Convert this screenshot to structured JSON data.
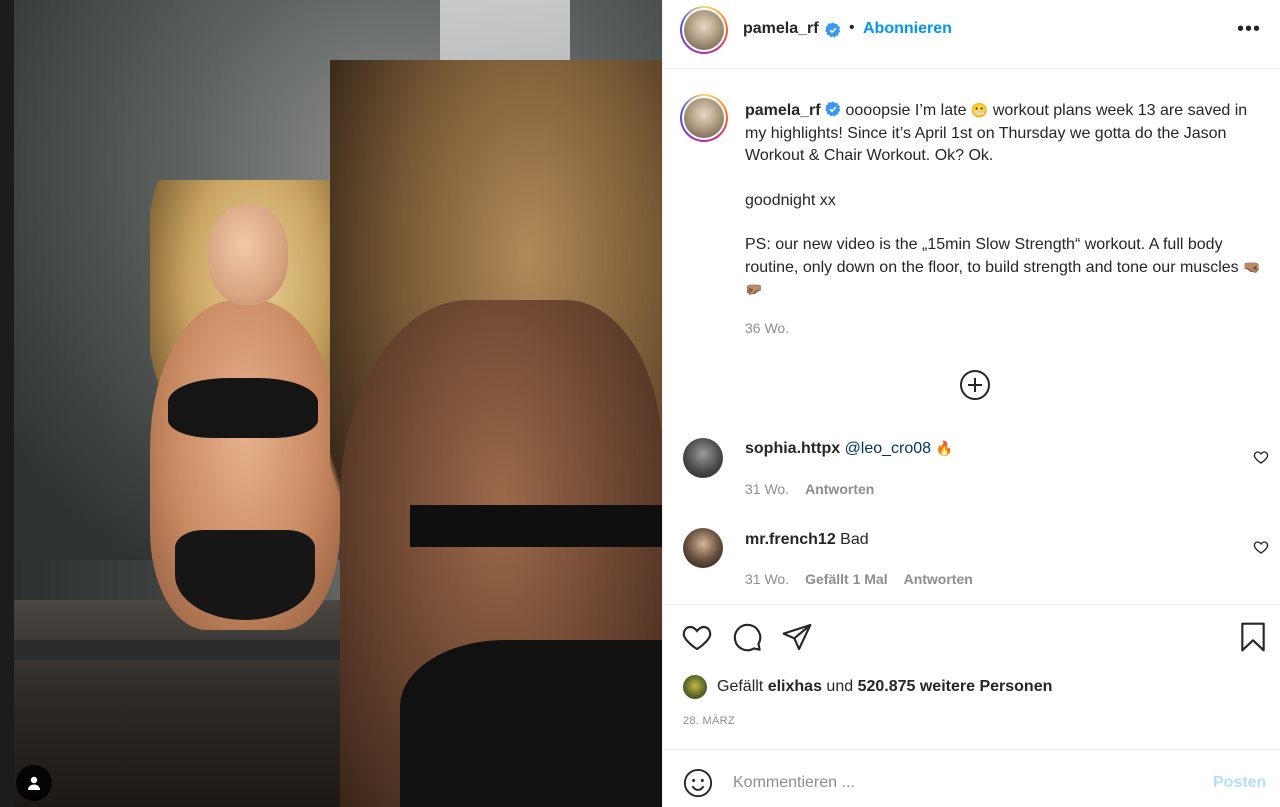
{
  "post": {
    "username": "pamela_rf",
    "follow_label": "Abonnieren",
    "separator": "•",
    "more_label": "•••"
  },
  "caption": {
    "username": "pamela_rf",
    "line1": "oooopsie I’m late",
    "emoji1": "😬",
    "line1b": "workout plans week 13 are saved in my highlights! Since it’s April 1st on Thursday we gotta do the Jason Workout & Chair Workout. Ok? Ok.",
    "line2": "goodnight xx",
    "line3": "PS: our new video is the „15min Slow Strength“ workout. A full body routine, only down on the floor, to build strength and tone our muscles",
    "emoji2": "🤜🏽🤛🏽",
    "time": "36 Wo."
  },
  "comments": [
    {
      "username": "sophia.httpx",
      "mention": "@leo_cro08",
      "emoji": "🔥",
      "text": "",
      "time": "31 Wo.",
      "likes": "",
      "reply_label": "Antworten"
    },
    {
      "username": "mr.french12",
      "mention": "",
      "emoji": "",
      "text": "Bad",
      "time": "31 Wo.",
      "likes": "Gefällt 1 Mal",
      "reply_label": "Antworten"
    }
  ],
  "likes": {
    "prefix": "Gefällt",
    "user": "elixhas",
    "middle": "und",
    "count": "520.875 weitere Personen"
  },
  "date": "28. MÄRZ",
  "comment_box": {
    "placeholder": "Kommentieren ...",
    "post_label": "Posten"
  },
  "colors": {
    "accent": "#0095f6",
    "mention": "#00376b",
    "muted": "#8e8e8e",
    "post_disabled": "#b2dffc"
  },
  "icons": [
    "user-tag-icon",
    "verified-badge-icon",
    "more-options-icon",
    "load-more-icon",
    "heart-icon",
    "comment-icon",
    "share-icon",
    "bookmark-icon",
    "emoji-icon"
  ]
}
